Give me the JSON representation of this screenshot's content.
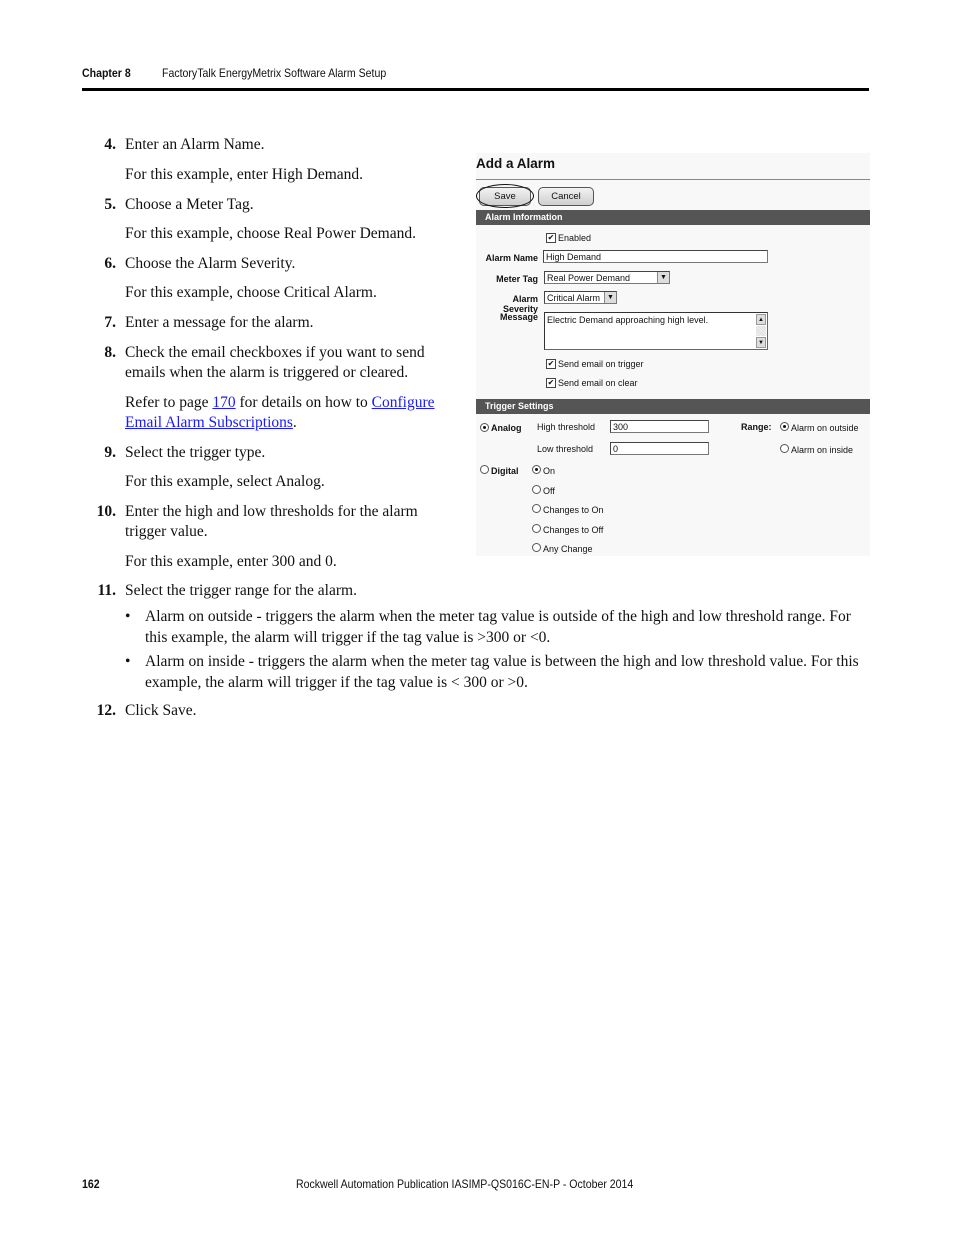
{
  "header": {
    "chapter": "Chapter 8",
    "title": "FactoryTalk EnergyMetrix Software Alarm Setup"
  },
  "steps": [
    {
      "num": "4.",
      "text": "Enter an Alarm Name.",
      "note": "For this example, enter High Demand."
    },
    {
      "num": "5.",
      "text": "Choose a Meter Tag.",
      "note": "For this example, choose Real Power Demand."
    },
    {
      "num": "6.",
      "text": "Choose the Alarm Severity.",
      "note": "For this example, choose Critical Alarm."
    },
    {
      "num": "7.",
      "text": "Enter a message for the alarm."
    },
    {
      "num": "8.",
      "text": "Check the email checkboxes if you want to send emails when the alarm is triggered or cleared.",
      "note_parts": {
        "pre": "Refer to page ",
        "page_link": "170",
        "mid": " for details on how to ",
        "topic_link": "Configure Email Alarm Subscriptions",
        "post": "."
      }
    },
    {
      "num": "9.",
      "text": "Select the trigger type.",
      "note": "For this example, select Analog."
    },
    {
      "num": "10.",
      "text": "Enter the high and low thresholds for the alarm trigger value.",
      "note": "For this example, enter 300 and 0."
    },
    {
      "num": "11.",
      "text": "Select the trigger range for the alarm.",
      "bullets": [
        "Alarm on outside - triggers the alarm when the meter tag value is outside of the high and low threshold range. For this example, the alarm will trigger if the tag value is >300 or <0.",
        "Alarm on inside - triggers the alarm when the meter tag value is between the high and low threshold value. For this example, the alarm will trigger if the tag value is < 300 or >0."
      ]
    },
    {
      "num": "12.",
      "text": "Click Save."
    }
  ],
  "form": {
    "title": "Add a Alarm",
    "save_label": "Save",
    "cancel_label": "Cancel",
    "alarm_info_section": "Alarm Information",
    "enabled_label": "Enabled",
    "enabled_checked": true,
    "alarm_name_label": "Alarm Name",
    "alarm_name_value": "High Demand",
    "meter_tag_label": "Meter Tag",
    "meter_tag_value": "Real Power Demand",
    "severity_label": "Alarm Severity",
    "severity_value": "Critical Alarm",
    "message_label": "Message",
    "message_value": "Electric Demand approaching high level.",
    "email_trigger_label": "Send email on trigger",
    "email_trigger_checked": true,
    "email_clear_label": "Send email on clear",
    "email_clear_checked": true,
    "trigger_section": "Trigger Settings",
    "analog_label": "Analog",
    "analog_selected": true,
    "high_threshold_label": "High threshold",
    "high_threshold_value": "300",
    "low_threshold_label": "Low threshold",
    "low_threshold_value": "0",
    "range_label": "Range:",
    "range_outside_label": "Alarm on outside",
    "range_inside_label": "Alarm on inside",
    "range_selected": "outside",
    "digital_label": "Digital",
    "digital_options": [
      "On",
      "Off",
      "Changes to On",
      "Changes to Off",
      "Any Change"
    ],
    "digital_selected": "On",
    "check_mark": "✔",
    "arrow_down": "▼",
    "arrow_up": "▲",
    "section_bar_color": "#555555"
  },
  "footer": {
    "page_number": "162",
    "publication": "Rockwell Automation Publication IASIMP-QS016C-EN-P - October 2014"
  }
}
